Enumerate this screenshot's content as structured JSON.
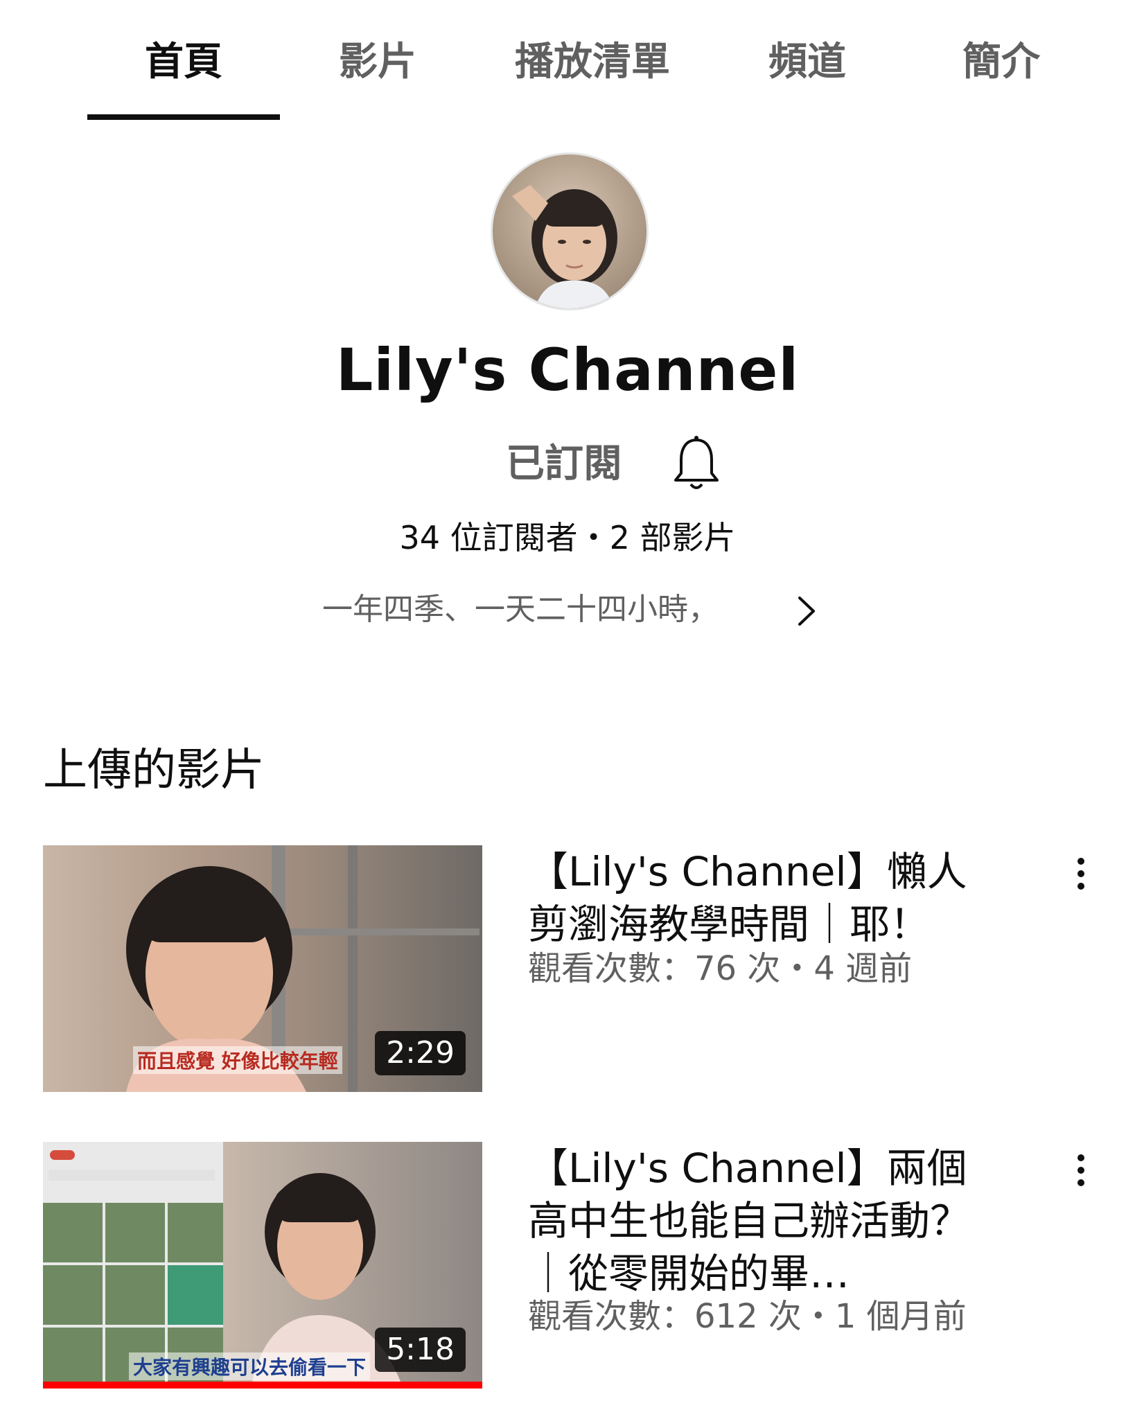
{
  "tabs": [
    {
      "label": "首頁",
      "active": true
    },
    {
      "label": "影片",
      "active": false
    },
    {
      "label": "播放清單",
      "active": false
    },
    {
      "label": "頻道",
      "active": false
    },
    {
      "label": "簡介",
      "active": false
    }
  ],
  "channel": {
    "name": "Lily's Channel",
    "subscribed_label": "已訂閱",
    "stats": "34 位訂閱者・2 部影片",
    "description": "一年四季、一天二十四小時，"
  },
  "section": {
    "title": "上傳的影片"
  },
  "videos": [
    {
      "title": "【Lily's Channel】懶人剪瀏海教學時間｜耶！",
      "meta": "觀看次數：76 次・4 週前",
      "duration": "2:29",
      "caption": "而且感覺 好像比較年輕"
    },
    {
      "title": "【Lily's Channel】兩個高中生也能自己辦活動？｜從零開始的畢…",
      "meta": "觀看次數：612 次・1 個月前",
      "duration": "5:18",
      "caption": "大家有興趣可以去偷看一下",
      "watched_fraction": 1.0
    }
  ],
  "colors": {
    "text": "#0f0f0f",
    "secondary": "#606060",
    "progress": "#ff0000"
  }
}
